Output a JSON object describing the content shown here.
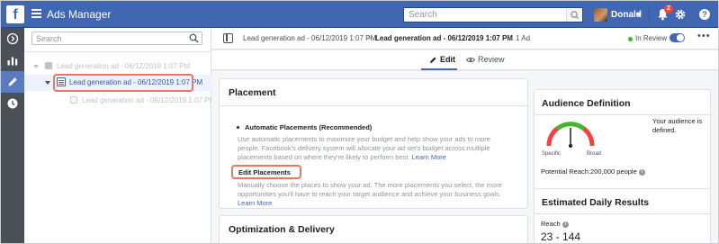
{
  "app": {
    "title": "Ads Manager",
    "search_placeholder": "Search",
    "user_name": "Donald",
    "notification_count": "2",
    "brand_color": "#4267b2"
  },
  "rail": {
    "icons": [
      "navigate-icon",
      "chart-icon",
      "pencil-icon",
      "clock-icon"
    ],
    "active": "pencil-icon"
  },
  "tree": {
    "search_placeholder": "Search",
    "campaign_label": "Lead generation ad - 06/12/2019 1:07 PM",
    "adset_label": "Lead generation ad - 06/12/2019 1:07 PM",
    "ad_label": "Lead generation ad - 06/12/2019 1:07 PM"
  },
  "breadcrumb": {
    "item1": "Lead generation ad - 06/12/2019 1:07 PM",
    "item2": "Lead generation ad - 06/12/2019 1:07 PM",
    "item3": "1 Ad",
    "separator": ">"
  },
  "status": {
    "label": "In Review",
    "toggle_on": true
  },
  "tabs": {
    "edit": "Edit",
    "review": "Review"
  },
  "placement": {
    "title": "Placement",
    "auto_title": "Automatic Placements (Recommended)",
    "auto_text": "Use automatic placements to maximize your budget and help show your ads to more people. Facebook's delivery system will allocate your ad set's budget across multiple placements based on where they're likely to perform best.",
    "auto_link": "Learn More",
    "edit_title": "Edit Placements",
    "edit_text": "Manually choose the places to show your ad. The more placements you select, the more opportunities you'll have to reach your target audience and achieve your business goals.",
    "edit_link": "Learn More"
  },
  "optimization": {
    "title": "Optimization & Delivery"
  },
  "audience": {
    "title": "Audience Definition",
    "gauge_left": "Specific",
    "gauge_right": "Broad",
    "summary": "Your audience is defined.",
    "potential_reach": "Potential Reach:200,000 people"
  },
  "estimated": {
    "title": "Estimated Daily Results",
    "reach_label": "Reach",
    "reach_value": "23 - 144"
  }
}
